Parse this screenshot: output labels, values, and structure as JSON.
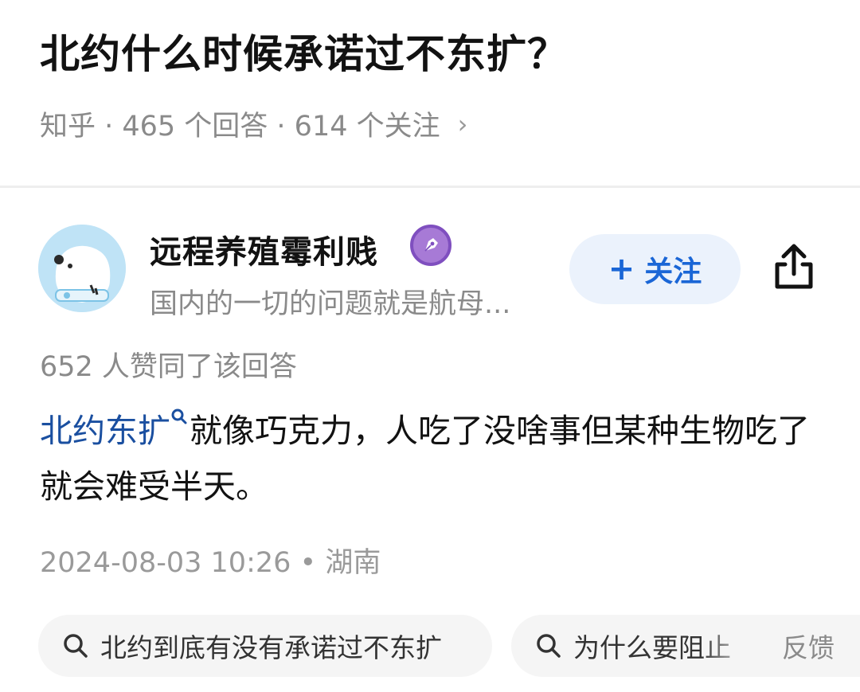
{
  "question": {
    "title": "北约什么时候承诺过不东扩？",
    "meta": "知乎 · 465 个回答 · 614 个关注",
    "chevron": "›"
  },
  "author": {
    "name": "远程养殖霉利贱",
    "bio": "国内的一切的问题就是航母...",
    "follow_label": "关注",
    "follow_plus": "+",
    "badge_icon": "pen-nib-icon"
  },
  "answer": {
    "votes": "652 人赞同了该回答",
    "link_text": "北约东扩",
    "text_after_link": "就像巧克力，人吃了没啥事但某种生物吃了就会难受半天。",
    "date": "2024-08-03 10:26",
    "separator": "•",
    "location": "湖南"
  },
  "related_searches": [
    {
      "label": "北约到底有没有承诺过不东扩"
    },
    {
      "label": "为什么要阻止"
    }
  ],
  "feedback_label": "反馈",
  "colors": {
    "accent": "#1a66d6",
    "link": "#1a4fa0",
    "follow_bg": "#ebf2fc",
    "badge": "#a77ad6"
  }
}
